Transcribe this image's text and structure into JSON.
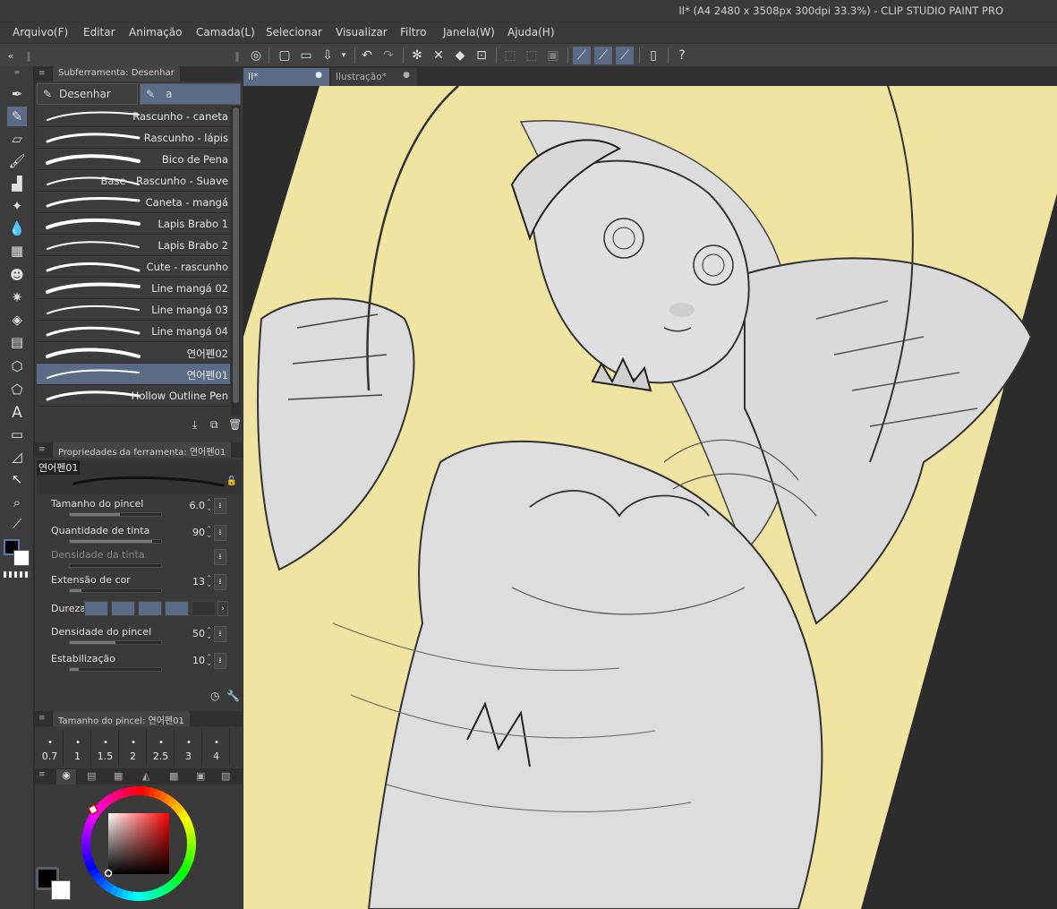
{
  "window": {
    "title": "II* (A4 2480 x 3508px 300dpi 33.3%)  - CLIP STUDIO PAINT PRO"
  },
  "menu": [
    "Arquivo(F)",
    "Editar",
    "Animação",
    "Camada(L)",
    "Selecionar",
    "Visualizar",
    "Filtro",
    "Janela(W)",
    "Ajuda(H)"
  ],
  "subtool_panel": {
    "header": "Subferramenta: Desenhar",
    "groups": [
      "Desenhar",
      "a"
    ],
    "brushes": [
      {
        "name": "Rascunho - caneta"
      },
      {
        "name": "Rascunho - lápis"
      },
      {
        "name": "Bico de Pena"
      },
      {
        "name": "Base - Rascunho - Suave"
      },
      {
        "name": "Caneta - mangá"
      },
      {
        "name": "Lapis Brabo 1"
      },
      {
        "name": "Lapis Brabo 2"
      },
      {
        "name": "Cute - rascunho"
      },
      {
        "name": "Line mangá 02"
      },
      {
        "name": "Line mangá 03"
      },
      {
        "name": "Line mangá 04"
      },
      {
        "name": "연어펜02"
      },
      {
        "name": "연어펜01"
      },
      {
        "name": "Hollow Outline Pen"
      }
    ],
    "selected_brush": "연어펜01"
  },
  "tool_properties": {
    "header": "Propriedades da ferramenta: 연어펜01",
    "preview_name": "연어펜01",
    "rows": [
      {
        "label": "Tamanho do pincel",
        "value": "6.0",
        "fill": 0.55
      },
      {
        "label": "Quantidade de tinta",
        "value": "90",
        "fill": 0.9
      },
      {
        "label": "Densidade da tinta",
        "value": "",
        "fill": 0
      },
      {
        "label": "Extensão de cor",
        "value": "13",
        "fill": 0.13
      },
      {
        "label": "Densidade do pincel",
        "value": "50",
        "fill": 0.5
      },
      {
        "label": "Estabilização",
        "value": "10",
        "fill": 0.1
      }
    ],
    "hardness_label": "Dureza",
    "hardness_level": 4
  },
  "brush_size_panel": {
    "header": "Tamanho do pincel: 연어펜01",
    "sizes": [
      "0.7",
      "1",
      "1.5",
      "2",
      "2.5",
      "3",
      "4"
    ]
  },
  "canvas_tabs": [
    "II*",
    "Ilustração*"
  ],
  "colors": {
    "accent": "#5b6b86",
    "main_color": "#000000",
    "sub_color": "#ffffff",
    "canvas_bg": "#f0e4a0"
  }
}
